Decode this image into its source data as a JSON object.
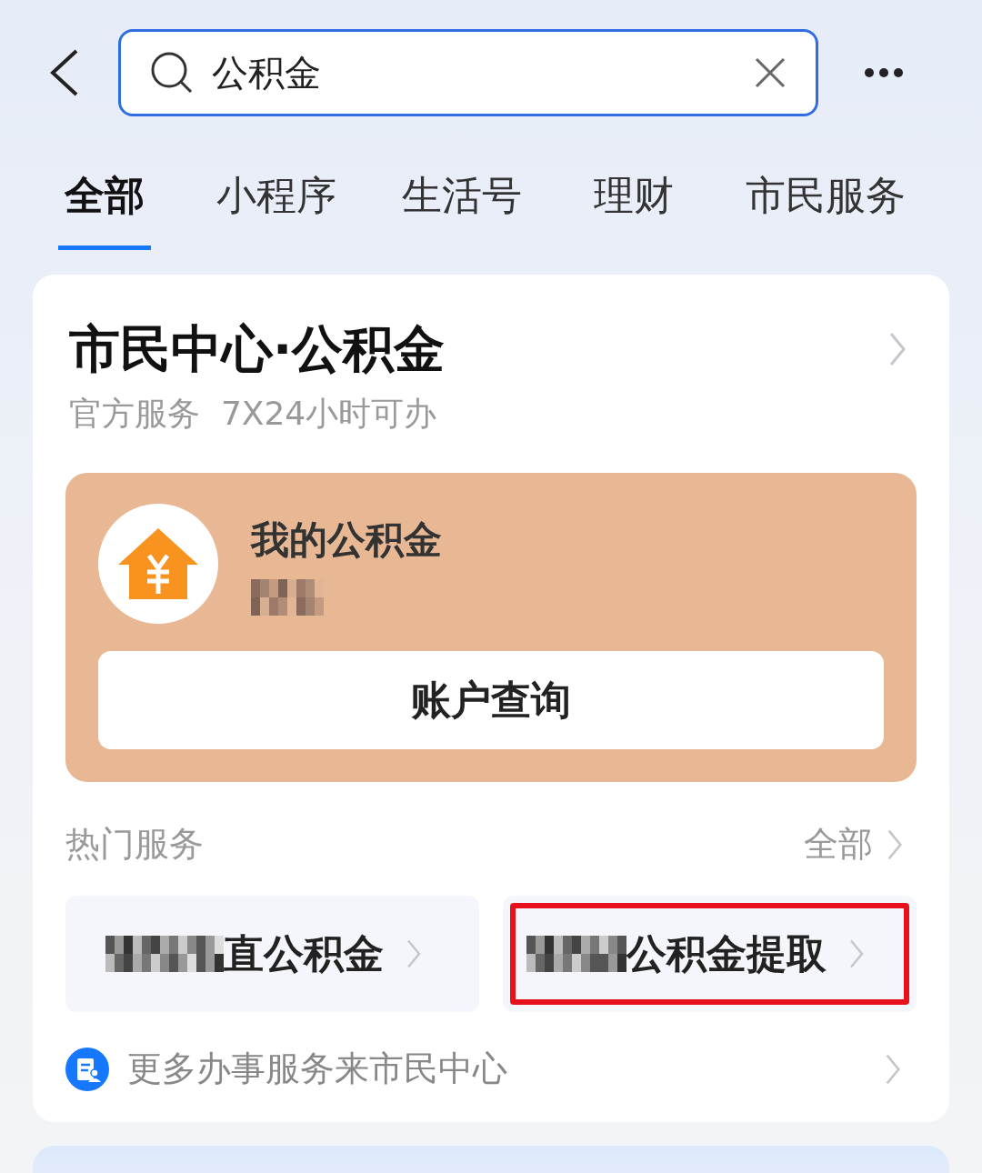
{
  "search": {
    "value": "公积金"
  },
  "tabs": [
    {
      "label": "全部",
      "selected": true
    },
    {
      "label": "小程序",
      "selected": false
    },
    {
      "label": "生活号",
      "selected": false
    },
    {
      "label": "理财",
      "selected": false
    },
    {
      "label": "市民服务",
      "selected": false
    }
  ],
  "card": {
    "title": "市民中心·公积金",
    "subtitle": "官方服务  7X24小时可办",
    "account": {
      "title": "我的公积金",
      "button": "账户查询"
    },
    "hot": {
      "label": "热门服务",
      "all_link": "全部",
      "services": [
        {
          "label": "直公积金",
          "highlighted": false
        },
        {
          "label": "公积金提取",
          "highlighted": true
        }
      ]
    },
    "more_link": "更多办事服务来市民中心"
  }
}
